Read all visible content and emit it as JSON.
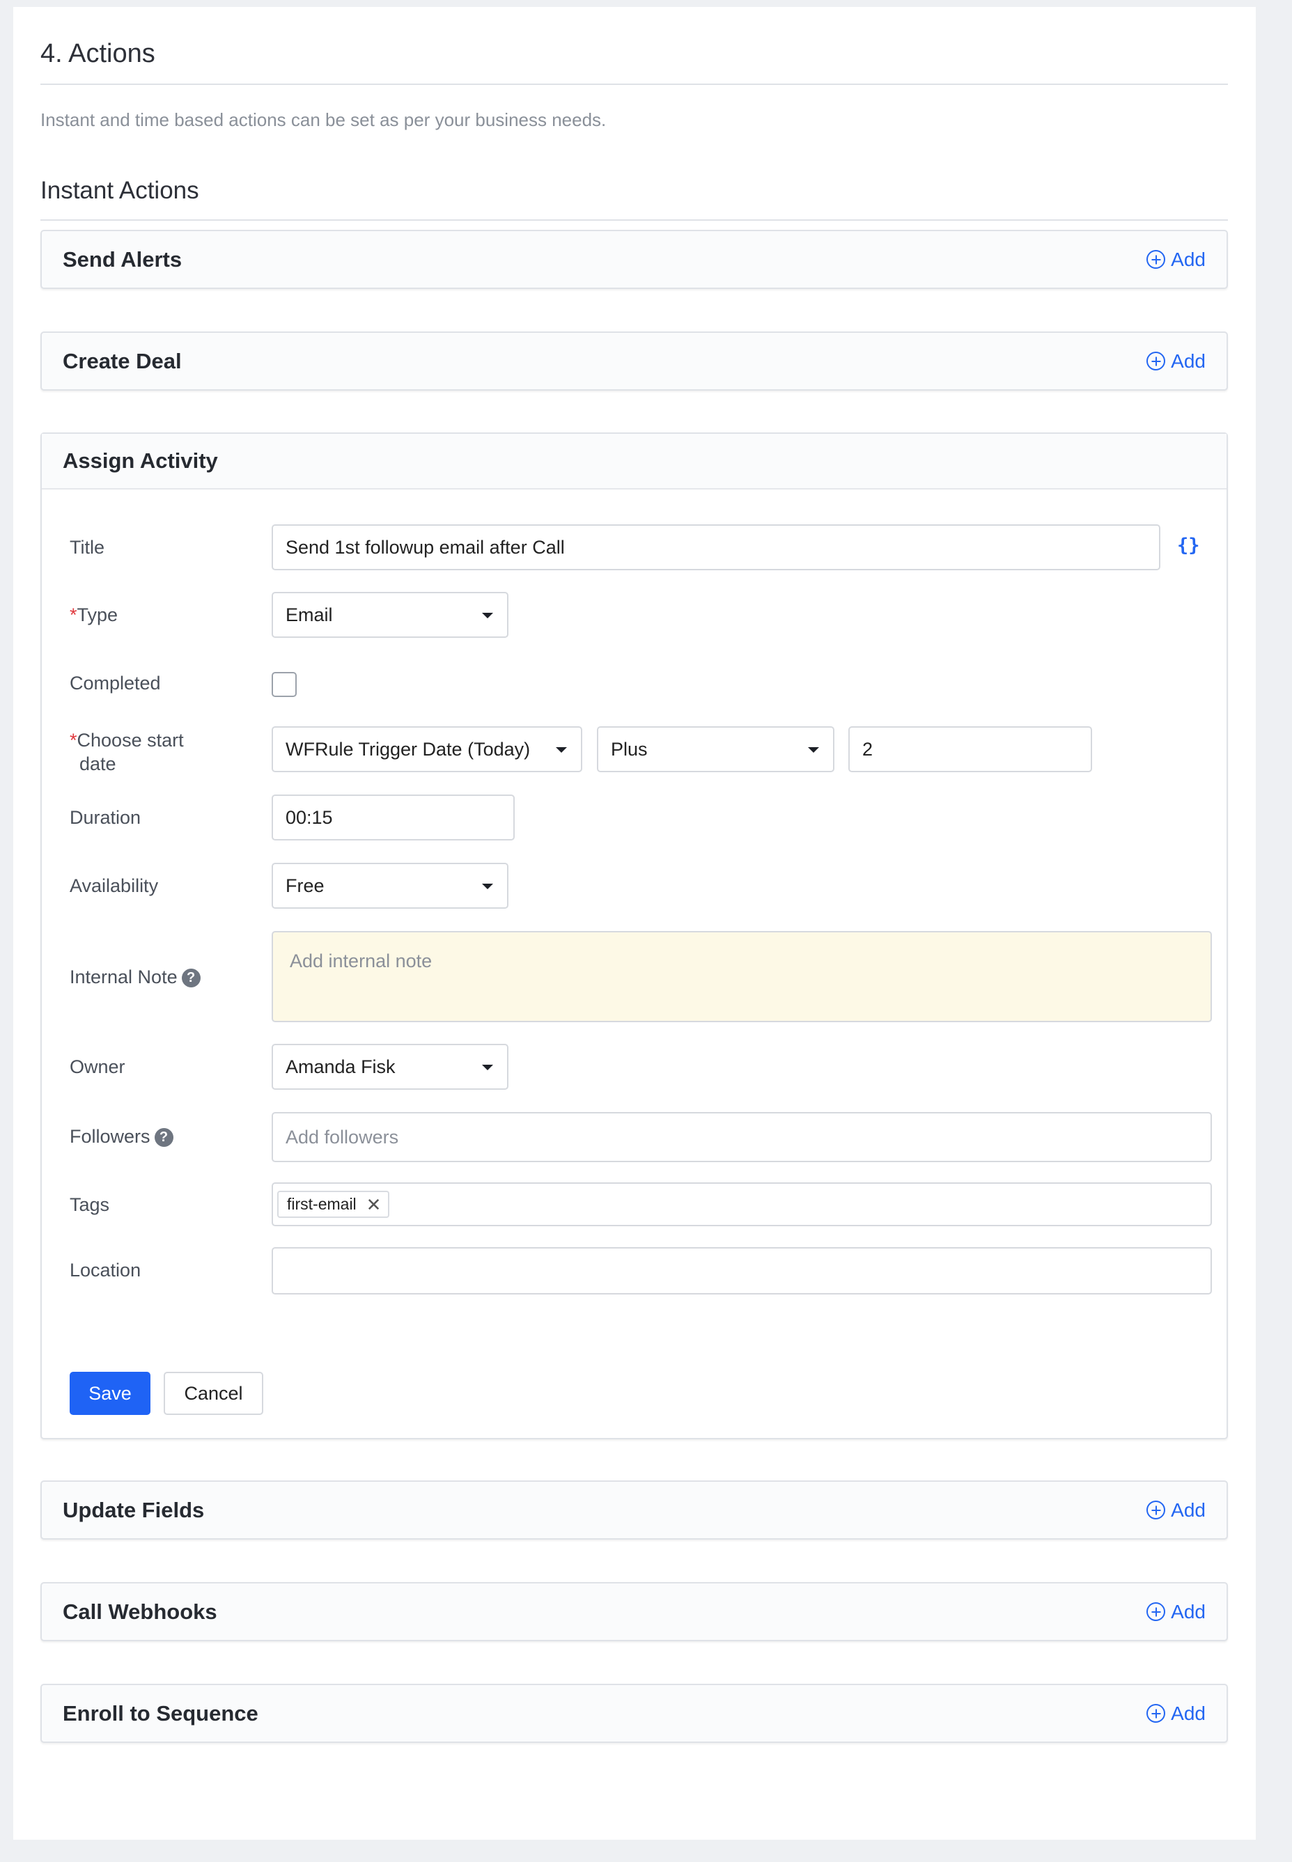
{
  "header": {
    "title": "4. Actions",
    "description": "Instant and time based actions can be set as per your business needs.",
    "subtitle": "Instant Actions"
  },
  "add_label": "Add",
  "panels": {
    "send_alerts": "Send Alerts",
    "create_deal": "Create Deal",
    "assign_activity": "Assign Activity",
    "update_fields": "Update Fields",
    "call_webhooks": "Call Webhooks",
    "enroll_sequence": "Enroll to Sequence"
  },
  "form": {
    "title_label": "Title",
    "title_value": "Send 1st followup email after Call",
    "variable_icon": "{}",
    "type_label": "Type",
    "type_value": "Email",
    "completed_label": "Completed",
    "start_date_label_line1": "Choose start",
    "start_date_label_line2": "date",
    "start_date_value": "WFRule Trigger Date (Today)",
    "operator_value": "Plus",
    "offset_value": "2",
    "duration_label": "Duration",
    "duration_value": "00:15",
    "availability_label": "Availability",
    "availability_value": "Free",
    "note_label": "Internal Note",
    "note_placeholder": "Add internal note",
    "owner_label": "Owner",
    "owner_value": "Amanda Fisk",
    "followers_label": "Followers",
    "followers_placeholder": "Add followers",
    "tags_label": "Tags",
    "tags": [
      "first-email"
    ],
    "location_label": "Location",
    "location_value": "",
    "save_label": "Save",
    "cancel_label": "Cancel"
  },
  "colors": {
    "accent": "#2366f2",
    "primary_button": "#1f63f5",
    "note_background": "#fdf9e6",
    "required": "#e0393e"
  }
}
